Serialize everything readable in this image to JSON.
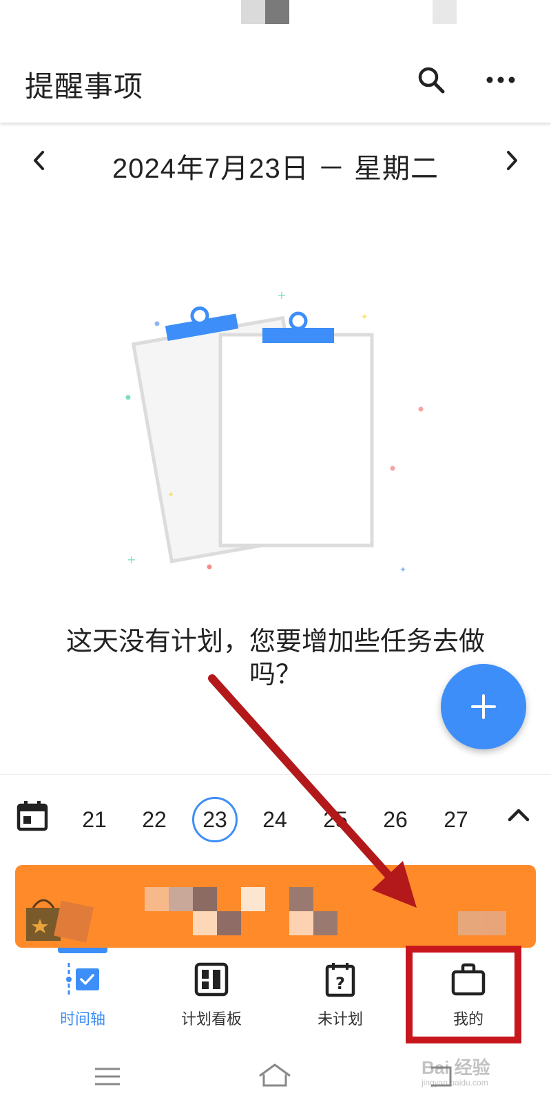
{
  "header": {
    "title": "提醒事项"
  },
  "date_nav": {
    "date_label": "2024年7月23日 － 星期二"
  },
  "empty_state": {
    "message": "这天没有计划，您要增加些任务去做吗？"
  },
  "week": {
    "days": [
      "21",
      "22",
      "23",
      "24",
      "25",
      "26",
      "27"
    ],
    "selected": "23"
  },
  "bottom_nav": {
    "items": [
      {
        "label": "时间轴",
        "active": true
      },
      {
        "label": "计划看板",
        "active": false
      },
      {
        "label": "未计划",
        "active": false
      },
      {
        "label": "我的",
        "active": false
      }
    ]
  },
  "watermark": {
    "text": "Bai 经验",
    "sub": "jingyan.baidu.com"
  },
  "colors": {
    "accent": "#3d8ef8",
    "highlight": "#c8161d",
    "banner": "#ff8a2a"
  },
  "icons": {
    "header": [
      "search-icon",
      "more-icon"
    ],
    "date_nav": [
      "chevron-left-icon",
      "chevron-right-icon"
    ],
    "fab": "plus-icon",
    "week": [
      "calendar-icon",
      "chevron-up-icon"
    ],
    "bottom_nav": [
      "timeline-icon",
      "board-icon",
      "unplanned-icon",
      "briefcase-icon"
    ],
    "system": [
      "menu-icon",
      "home-icon",
      "back-icon"
    ]
  }
}
